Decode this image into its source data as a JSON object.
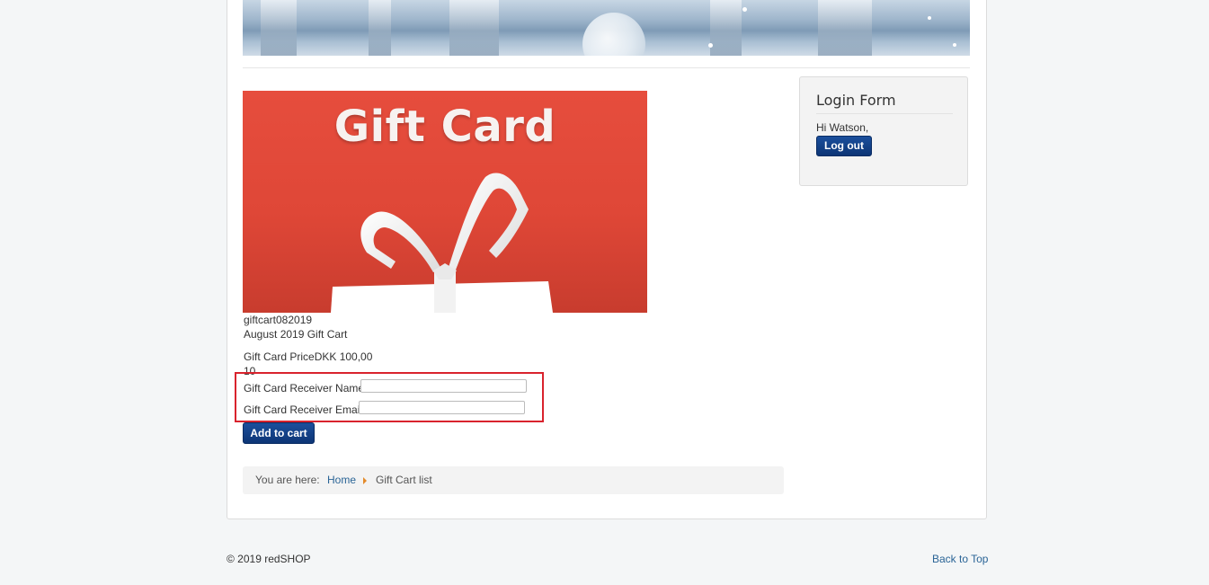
{
  "product": {
    "image_heading": "Gift Card",
    "number": "giftcart082019",
    "name": "August 2019 Gift Cart",
    "price_label": "Gift Card Price",
    "price_value": "DKK 100,00",
    "quantity": "10"
  },
  "form": {
    "receiver_name_label": "Gift Card Receiver Name",
    "receiver_name_value": "",
    "receiver_email_label": "Gift Card Receiver Email",
    "receiver_email_value": "",
    "add_to_cart_label": "Add to cart"
  },
  "breadcrumb": {
    "prefix": "You are here:",
    "home": "Home",
    "current": "Gift Cart list",
    "separator_color": "#e38a2a"
  },
  "login": {
    "title": "Login Form",
    "greeting": "Hi Watson,",
    "logout_label": "Log out"
  },
  "footer": {
    "copyright": "© 2019 redSHOP",
    "back_to_top": "Back to Top"
  },
  "colors": {
    "button": "#0d3575",
    "link": "#2a6496",
    "highlight": "#d9232d",
    "gift_card": "#e64d3d"
  }
}
